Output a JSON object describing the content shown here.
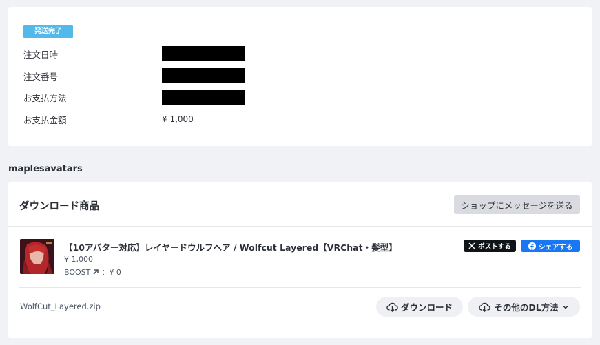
{
  "order": {
    "status_badge": "発送完了",
    "rows": [
      {
        "label": "注文日時",
        "value": ""
      },
      {
        "label": "注文番号",
        "value": ""
      },
      {
        "label": "お支払方法",
        "value": ""
      },
      {
        "label": "お支払金額",
        "value": "¥ 1,000"
      }
    ]
  },
  "shop": {
    "name": "maplesavatars"
  },
  "downloads": {
    "title": "ダウンロード商品",
    "message_button": "ショップにメッセージを送る",
    "product": {
      "name": "【10アバター対応】レイヤードウルフヘア / Wolfcut Layered【VRChat・髪型】",
      "price": "¥ 1,000",
      "boost_label": "BOOST",
      "boost_value": "：¥ 0"
    },
    "post_button": "ポストする",
    "share_button": "シェアする",
    "file": {
      "name": "WolfCut_Layered.zip",
      "download_button": "ダウンロード",
      "other_button": "その他のDL方法"
    }
  },
  "colors": {
    "badge": "#52b9ea",
    "x_button": "#0f1419",
    "facebook": "#1877f2",
    "page_bg": "#f0f2f5"
  },
  "icons": [
    "x-logo-icon",
    "facebook-icon",
    "cloud-download-icon",
    "chevron-down-icon",
    "boost-arrow-icon"
  ]
}
